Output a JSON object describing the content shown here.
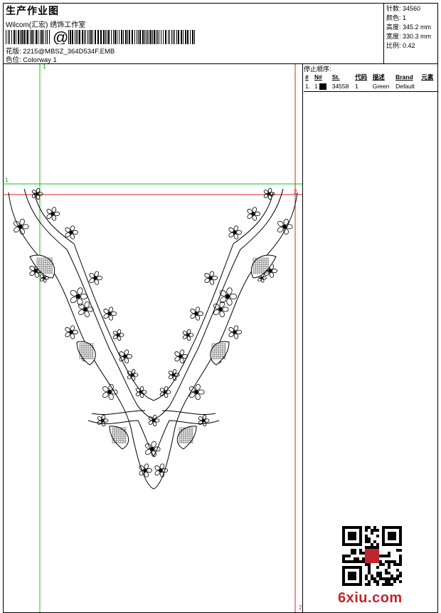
{
  "header": {
    "title": "生产作业图",
    "company": "Wilcom(汇宏) 绣饰工作室",
    "barcode_char": "@",
    "design_label": "花版:",
    "design_value": "2215@MBSZ_364D534F.EMB",
    "colorway_label": "色位:",
    "colorway_value": "Colorway 1"
  },
  "stats": [
    {
      "label": "针数:",
      "value": "34560"
    },
    {
      "label": "颜色:",
      "value": "1"
    },
    {
      "label": "高度:",
      "value": "345.2 mm"
    },
    {
      "label": "宽度:",
      "value": "330.3 mm"
    },
    {
      "label": "比例:",
      "value": "0.42"
    }
  ],
  "stop_sequence": {
    "title": "停止顺序:",
    "columns": [
      "#",
      "N#",
      "St.",
      "代码",
      "描述",
      "Brand",
      "元素"
    ],
    "rows": [
      {
        "idx": "1.",
        "needle": "1",
        "stitches": "34558",
        "code": "1",
        "description": "Green",
        "brand": "Default",
        "element": ""
      }
    ]
  },
  "guides": {
    "top_left_label": "1",
    "mid_left_label": "1",
    "right_label": "2",
    "bottom_right_label": "2",
    "vertical_color": "#00d000",
    "horizontal_color": "#00d000",
    "red_color": "#e02020"
  },
  "watermark": {
    "text": "6xiu.com",
    "color": "#c0262d"
  },
  "icons": [
    "qr-code-icon",
    "design-swatch-icon"
  ]
}
